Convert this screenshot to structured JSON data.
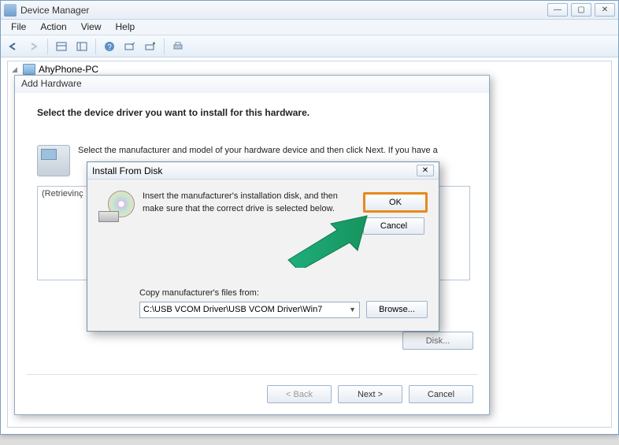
{
  "window": {
    "title": "Device Manager",
    "min": "—",
    "max": "▢",
    "close": "✕"
  },
  "menu": {
    "file": "File",
    "action": "Action",
    "view": "View",
    "help": "Help"
  },
  "tree": {
    "root": "AhyPhone-PC"
  },
  "wizard": {
    "title": "Add Hardware",
    "heading": "Select the device driver you want to install for this hardware.",
    "instruction": "Select the manufacturer and model of your hardware device and then click Next. If you have a",
    "list_placeholder": "(Retrievinç",
    "have_disk": "Disk...",
    "back": "< Back",
    "next": "Next >",
    "cancel": "Cancel"
  },
  "ifd": {
    "title": "Install From Disk",
    "close": "✕",
    "instruction": "Insert the manufacturer's installation disk, and then make sure that the correct drive is selected below.",
    "ok": "OK",
    "cancel": "Cancel",
    "copy_label": "Copy manufacturer's files from:",
    "path": "C:\\USB VCOM Driver\\USB VCOM Driver\\Win7",
    "browse": "Browse..."
  }
}
